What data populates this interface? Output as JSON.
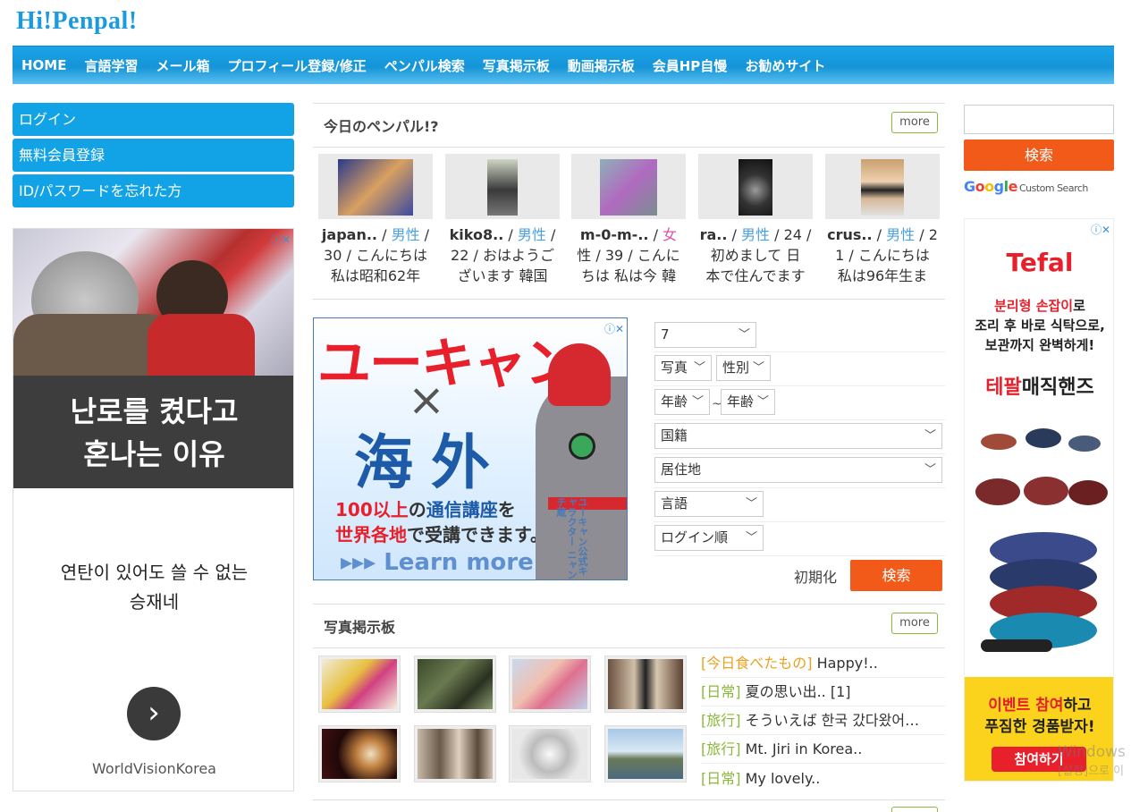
{
  "site": {
    "logo": "Hi!Penpal!"
  },
  "nav": [
    "HOME",
    "言語学習",
    "メール箱",
    "プロフィール登録/修正",
    "ペンパル検索",
    "写真掲示板",
    "動画掲示板",
    "会員HP自慢",
    "お勧めサイト"
  ],
  "sidebar": {
    "login": "ログイン",
    "register": "無料会員登録",
    "forgot": "ID/パスワードを忘れた方"
  },
  "ad_left": {
    "headline_1": "난로를 켰다고",
    "headline_2": "혼나는 이유",
    "sub_1": "연탄이 있어도 쓸 수 없는",
    "sub_2": "승재네",
    "brand": "WorldVisionKorea",
    "arrow": "›"
  },
  "today": {
    "title": "今日のペンパル!?",
    "more": "more",
    "penpals": [
      {
        "nick": "japan..",
        "gender": "男性",
        "gender_type": "male",
        "line1_rest": "/",
        "line2": "30 / こんにちは",
        "line3": "私は昭和62年"
      },
      {
        "nick": "kiko8..",
        "gender": "男性",
        "gender_type": "male",
        "line1_rest": "/",
        "line2": "22 / おはようご",
        "line3": "ざいます 韓国"
      },
      {
        "nick": "m-0-m-..",
        "gender": "女",
        "gender_type": "female",
        "line1_rest": "",
        "line2": "性 / 39 / こんに",
        "line3": "ちは 私は今 韓"
      },
      {
        "nick": "ra..",
        "gender": "男性",
        "gender_type": "male",
        "line1_rest": "/ 24 /",
        "line2": "初めまして 日",
        "line3": "本で住んでます"
      },
      {
        "nick": "crus..",
        "gender": "男性",
        "gender_type": "male",
        "line1_rest": "/ 2",
        "line2": "1 / こんにちは",
        "line3": "私は96年生ま"
      }
    ]
  },
  "ad_mid": {
    "headline": "ユーキャン",
    "cross": "×",
    "kaigai": "海外",
    "line1_a": "100以上",
    "line1_b": "の",
    "line1_c": "通信講座",
    "line1_d": "を",
    "line2_a": "世界各地",
    "line2_b": "で受講できます。",
    "learn": "▸▸▸ Learn more",
    "vertical": "ユーキャン公式キャラクター ニャンチ蔵"
  },
  "search_form": {
    "count": "7",
    "photo": "写真",
    "gender": "性別",
    "age_from": "年齢",
    "tilde": "~",
    "age_to": "年齢",
    "nationality": "国籍",
    "residence": "居住地",
    "language": "言語",
    "order": "ログイン順",
    "reset": "初期化",
    "search": "検索"
  },
  "photo_board": {
    "title": "写真掲示板",
    "more": "more",
    "items": [
      {
        "cat": "[今日食べたもの]",
        "cat_style": "orange",
        "text": " Happy!.."
      },
      {
        "cat": "[日常]",
        "cat_style": "green",
        "text": " 夏の思い出.. [1]"
      },
      {
        "cat": "[旅行]",
        "cat_style": "green",
        "text": " そういえば 한국 갔다왔어…"
      },
      {
        "cat": "[旅行]",
        "cat_style": "green",
        "text": " Mt. Jiri in Korea.."
      },
      {
        "cat": "[日常]",
        "cat_style": "green",
        "text": " My lovely.."
      }
    ]
  },
  "right_search": {
    "button": "検索",
    "google": "Google",
    "custom": "Custom Search"
  },
  "ad_right": {
    "brand": "Tefal",
    "k1_red": "분리형 손잡이",
    "k1_a": "로",
    "k1_b": "조리 후 바로 식탁으로,",
    "k1_c": "보관까지 완벽하게!",
    "k2_red": "테팔",
    "k2_rest": "매직핸즈",
    "y1_red": "이벤트 참여",
    "y1_a": "하고",
    "y1_b": "푸짐한 경품받자!",
    "y_btn": "참여하기"
  },
  "watermark": {
    "line1": "Windows",
    "line2": "[설정]으로 이"
  },
  "colors": {
    "brand_blue": "#1a9ae0",
    "orange": "#f25a19",
    "green": "#8ab83a"
  }
}
